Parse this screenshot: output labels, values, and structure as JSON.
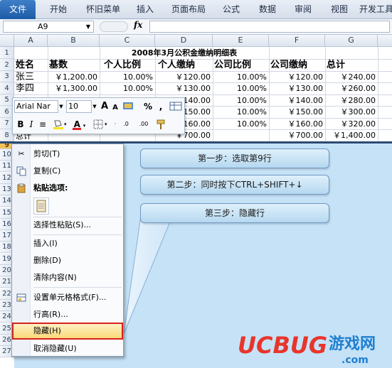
{
  "ribbon": {
    "tabs": [
      "文件",
      "开始",
      "怀旧菜单",
      "插入",
      "页面布局",
      "公式",
      "数据",
      "审阅",
      "视图",
      "开发工具"
    ]
  },
  "formula_bar": {
    "cell_ref": "A9",
    "fx": "fx",
    "value": ""
  },
  "columns": [
    "A",
    "B",
    "C",
    "D",
    "E",
    "F",
    "G"
  ],
  "rows": [
    "1",
    "2",
    "3",
    "4",
    "5",
    "6",
    "7",
    "8",
    "9",
    "10",
    "11",
    "12",
    "13",
    "14",
    "15",
    "16",
    "17",
    "18",
    "19",
    "20",
    "21",
    "22",
    "23",
    "24",
    "25",
    "26",
    "27"
  ],
  "sheet": {
    "title": "2008年3月公积金缴纳明细表",
    "headers": [
      "姓名",
      "基数",
      "个人比例",
      "个人缴纳",
      "公司比例",
      "公司缴纳",
      "总计"
    ],
    "data_rows": [
      {
        "name": "张三",
        "base": "￥1,200.00",
        "p_rate": "10.00%",
        "p_pay": "￥120.00",
        "c_rate": "10.00%",
        "c_pay": "￥120.00",
        "total": "￥240.00"
      },
      {
        "name": "李四",
        "base": "￥1,300.00",
        "p_rate": "10.00%",
        "p_pay": "￥130.00",
        "c_rate": "10.00%",
        "c_pay": "￥130.00",
        "total": "￥260.00"
      },
      {
        "name": "",
        "base": "",
        "p_rate": "",
        "p_pay": "￥140.00",
        "c_rate": "10.00%",
        "c_pay": "￥140.00",
        "total": "￥280.00"
      },
      {
        "name": "",
        "base": "",
        "p_rate": "",
        "p_pay": "￥150.00",
        "c_rate": "10.00%",
        "c_pay": "￥150.00",
        "total": "￥300.00"
      },
      {
        "name": "",
        "base": "",
        "p_rate": "",
        "p_pay": "￥160.00",
        "c_rate": "10.00%",
        "c_pay": "￥160.00",
        "total": "￥320.00"
      }
    ],
    "total_row": {
      "name": "总计",
      "p_pay": "￥700.00",
      "c_pay": "￥700.00",
      "total": "￥1,400.00"
    }
  },
  "mini_toolbar": {
    "font": "Arial Nar",
    "size": "10",
    "grow": "A",
    "shrink": "A",
    "percent": "%",
    "comma": ",",
    "bold": "B",
    "italic": "I",
    "align": "≡",
    "font_color": "A",
    "dec_inc": ".0",
    "dec_dec": ".00"
  },
  "context_menu": {
    "items": [
      "剪切(T)",
      "复制(C)",
      "粘贴选项:",
      "选择性粘贴(S)...",
      "插入(I)",
      "删除(D)",
      "清除内容(N)",
      "设置单元格格式(F)...",
      "行高(R)...",
      "隐藏(H)",
      "取消隐藏(U)"
    ]
  },
  "callouts": {
    "step1": "第一步：选取第9行",
    "step2": "第二步：同时按下CTRL+SHIFT+↓",
    "step3": "第三步：隐藏行"
  },
  "logo": {
    "brand": "UCBUG",
    "cn": "游戏网",
    "domain": ".com"
  },
  "colors": {
    "accent": "#1e5ba6",
    "highlight_border": "#d8201c",
    "callout_bg": "#c6e2f7",
    "logo_red": "#e8352b",
    "logo_blue": "#1f7fd0"
  }
}
